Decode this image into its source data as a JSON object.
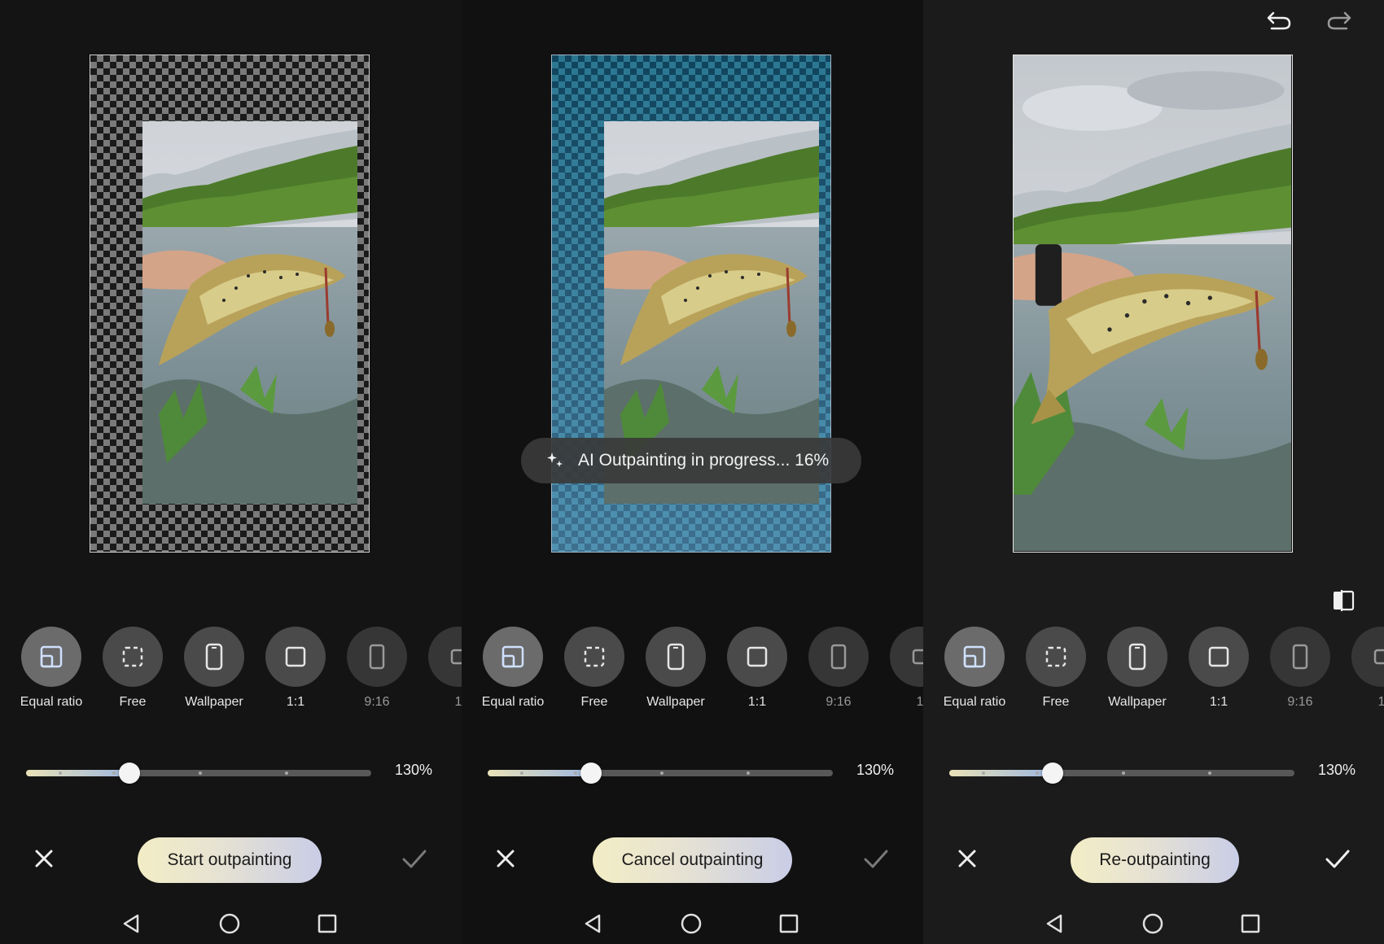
{
  "theme": {
    "background": "#121212",
    "accent_gradient_start": "#f3edc5",
    "accent_gradient_end": "#c9cde6",
    "slider_fill_start": "#e9e2b7",
    "slider_fill_end": "#9db6e0"
  },
  "ratio_options": [
    {
      "label": "Equal ratio",
      "icon": "equal-ratio-icon",
      "selected": true
    },
    {
      "label": "Free",
      "icon": "free-crop-icon",
      "selected": false
    },
    {
      "label": "Wallpaper",
      "icon": "phone-icon",
      "selected": false
    },
    {
      "label": "1:1",
      "icon": "square-icon",
      "selected": false
    },
    {
      "label": "9:16",
      "icon": "portrait-icon",
      "selected": false
    },
    {
      "label": "1",
      "icon": "partial-ratio-icon",
      "selected": false
    }
  ],
  "zoom": {
    "value_label": "130%",
    "level": 0.3
  },
  "panels": [
    {
      "action_label": "Start outpainting",
      "state": "preview"
    },
    {
      "action_label": "Cancel outpainting",
      "state": "processing",
      "progress_text": "AI Outpainting in progress... 16%"
    },
    {
      "action_label": "Re-outpainting",
      "state": "result"
    }
  ],
  "top_bar": {
    "undo_icon": "undo-icon",
    "redo_icon": "redo-icon"
  },
  "navigation": {
    "back_icon": "back-triangle-icon",
    "home_icon": "home-circle-icon",
    "recents_icon": "recents-square-icon"
  }
}
